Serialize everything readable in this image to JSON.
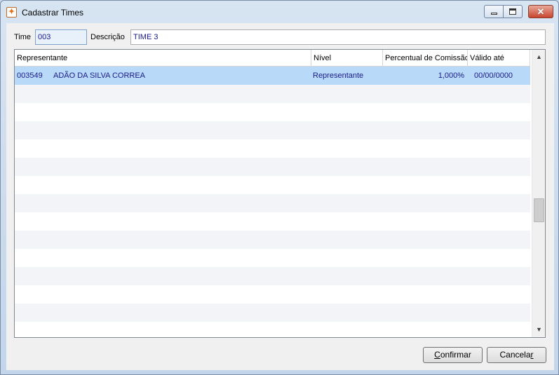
{
  "window": {
    "title": "Cadastrar Times",
    "app_icon": "app-logo-icon",
    "controls": {
      "minimize_icon": "minimize-icon",
      "maximize_icon": "maximize-icon",
      "close_icon": "close-icon"
    }
  },
  "form": {
    "time_label": "Time",
    "time_value": "003",
    "descricao_label": "Descrição",
    "descricao_value": "TIME 3"
  },
  "grid": {
    "columns": [
      "Representante",
      "Nível",
      "Percentual de Comissão",
      "Válido até"
    ],
    "rows": [
      {
        "codigo": "003549",
        "nome": "ADÃO DA SILVA CORREA",
        "nivel": "Representante",
        "percentual": "1,000%",
        "valido_ate": "00/00/0000",
        "selected": true
      }
    ],
    "empty_rows": 14,
    "scroll": {
      "thumb_position": 0.52,
      "thumb_size": 0.09
    }
  },
  "buttons": {
    "confirmar": {
      "accel": "C",
      "rest": "onfirmar"
    },
    "cancelar": {
      "accel": "Cancela",
      "rest_u": "r"
    }
  },
  "colors": {
    "selection": "#b8d9f8",
    "alt_row": "#f2f4f8",
    "text_value": "#1a1a8a",
    "close_button": "#c7452f"
  }
}
